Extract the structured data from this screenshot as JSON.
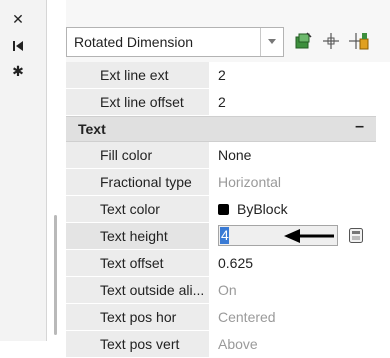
{
  "side_strip": {
    "icons": [
      "close-icon",
      "auto-hide-icon",
      "settings-icon"
    ]
  },
  "toolbar": {
    "selection_type": "Rotated Dimension",
    "icons": [
      "quick-select-icon",
      "select-objects-icon",
      "toggle-pickadd-icon"
    ]
  },
  "rows_top": [
    {
      "name": "Ext line ext",
      "value": "2"
    },
    {
      "name": "Ext line offset",
      "value": "2"
    }
  ],
  "section_text": {
    "title": "Text",
    "collapse": "–"
  },
  "rows_text": [
    {
      "name": "Fill color",
      "value": "None"
    },
    {
      "name": "Fractional type",
      "value": "Horizontal"
    },
    {
      "name": "Text color",
      "value": "ByBlock"
    },
    {
      "name": "Text height",
      "value": "4"
    },
    {
      "name": "Text offset",
      "value": "0.625"
    },
    {
      "name": "Text outside ali...",
      "value": "On"
    },
    {
      "name": "Text pos hor",
      "value": "Centered"
    },
    {
      "name": "Text pos vert",
      "value": "Above"
    }
  ],
  "colors": {
    "selection": "#3a7bd5",
    "text_color_swatch": "#000000"
  }
}
